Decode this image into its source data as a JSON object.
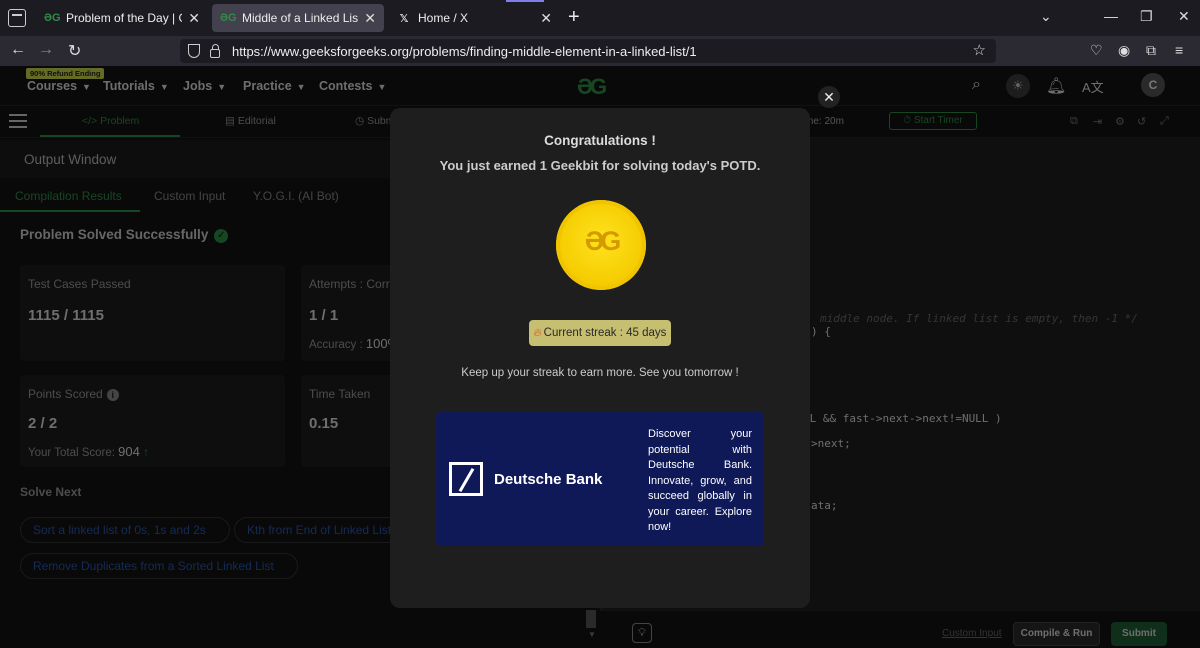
{
  "browser": {
    "tabs": [
      {
        "title": "Problem of the Day | GeeksforG",
        "icon": "gfg-favicon",
        "active": false
      },
      {
        "title": "Middle of a Linked List | Practic",
        "icon": "gfg-favicon",
        "active": true
      },
      {
        "title": "Home / X",
        "icon": "x-favicon",
        "active": false
      }
    ],
    "url": "https://www.geeksforgeeks.org/problems/finding-middle-element-in-a-linked-list/1"
  },
  "header": {
    "badge": "90% Refund Ending",
    "menu": [
      "Courses",
      "Tutorials",
      "Jobs",
      "Practice",
      "Contests"
    ],
    "avatar_letter": "C"
  },
  "toolbar": {
    "tabs": [
      "Problem",
      "Editorial",
      "Subm"
    ],
    "timer_text": "me: 20m",
    "start_timer": "Start Timer"
  },
  "output": {
    "title": "Output Window",
    "tabs": [
      "Compilation Results",
      "Custom Input",
      "Y.O.G.I. (AI Bot)"
    ],
    "status": "Problem Solved Successfully",
    "cards": {
      "test_cases_label": "Test Cases Passed",
      "test_cases_value": "1115 / 1115",
      "attempts_label": "Attempts : Corre",
      "attempts_value": "1 / 1",
      "accuracy_label": "Accuracy :",
      "accuracy_value": "100%",
      "points_label": "Points Scored",
      "points_value": "2 / 2",
      "total_label": "Your Total Score:",
      "total_value": "904",
      "time_label": "Time Taken",
      "time_value": "0.15"
    },
    "solve_next_title": "Solve Next",
    "solve_next": [
      "Sort a linked list of 0s, 1s and 2s",
      "Kth from End of Linked List",
      "Remove Duplicates from a Sorted Linked List"
    ]
  },
  "editor": {
    "lines": [
      {
        "text": "middle node. If linked list is empty, then -1 */",
        "type": "comment"
      },
      {
        "text": ") {",
        "type": "code"
      },
      {
        "text": "LL && fast->next->next!=NULL )",
        "type": "code"
      },
      {
        "text": ">next;",
        "type": "code"
      },
      {
        "text": "ata;",
        "type": "code"
      }
    ],
    "custom_input": "Custom Input",
    "compile_run": "Compile & Run",
    "submit": "Submit"
  },
  "modal": {
    "title": "Congratulations !",
    "message": "You just earned 1 Geekbit for solving today's POTD.",
    "streak": "Current streak : 45 days",
    "footer": "Keep up your streak to earn more. See you tomorrow !",
    "ad": {
      "brand": "Deutsche Bank",
      "text": "Discover your potential with Deutsche Bank. Innovate, grow, and succeed globally in your career. Explore now!"
    }
  },
  "colors": {
    "gfg_green": "#2f8d46",
    "coin_yellow": "#f5cc00",
    "streak_badge": "#c6be70",
    "ad_background": "#0f1957",
    "link_blue": "#2b55a8"
  }
}
